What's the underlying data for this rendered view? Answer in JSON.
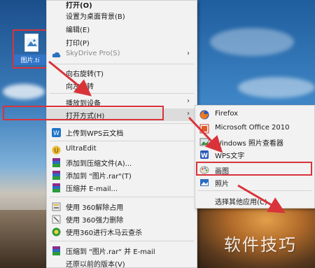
{
  "desktop": {
    "icon_label": "图片.ti"
  },
  "context_menu": {
    "items": [
      {
        "label": "打开(O)",
        "icon": "none"
      },
      {
        "label": "设置为桌面背景(B)",
        "icon": "none"
      },
      {
        "label": "编辑(E)",
        "icon": "none"
      },
      {
        "label": "打印(P)",
        "icon": "none"
      },
      {
        "label": "SkyDrive Pro(S)",
        "icon": "cloud-icon",
        "disabled": true,
        "submenu": true
      },
      {
        "label": "向右旋转(T)",
        "icon": "none"
      },
      {
        "label": "向左旋转",
        "icon": "none"
      },
      {
        "label": "播放到设备",
        "icon": "none",
        "submenu": true
      },
      {
        "label": "打开方式(H)",
        "icon": "none",
        "submenu": true,
        "highlighted": true
      },
      {
        "label": "上传到WPS云文档",
        "icon": "wps-cloud-icon"
      },
      {
        "label": "UltraEdit",
        "icon": "ultraedit-icon"
      },
      {
        "label": "添加到压缩文件(A)...",
        "icon": "winrar-icon"
      },
      {
        "label": "添加到 \"图片.rar\"(T)",
        "icon": "winrar-icon"
      },
      {
        "label": "压缩并 E-mail...",
        "icon": "winrar-icon"
      },
      {
        "label": "使用 360解除占用",
        "icon": "360-unlock-icon"
      },
      {
        "label": "使用 360强力删除",
        "icon": "360-delete-icon"
      },
      {
        "label": "使用360进行木马云查杀",
        "icon": "360-scan-icon"
      },
      {
        "label": "压缩到 \"图片.rar\" 并 E-mail",
        "icon": "winrar-icon"
      },
      {
        "label": "还原以前的版本(V)",
        "icon": "none"
      }
    ]
  },
  "open_with_submenu": {
    "items": [
      {
        "label": "Firefox",
        "icon": "firefox-icon"
      },
      {
        "label": "Microsoft Office 2010",
        "icon": "office-icon"
      },
      {
        "label": "Windows 照片查看器",
        "icon": "photo-viewer-icon"
      },
      {
        "label": "WPS文字",
        "icon": "wps-writer-icon"
      },
      {
        "label": "画图",
        "icon": "paint-icon",
        "highlighted": true
      },
      {
        "label": "照片",
        "icon": "photos-icon"
      },
      {
        "label": "选择其他应用(C)",
        "icon": "none"
      }
    ]
  },
  "watermark": "软件技巧",
  "colors": {
    "highlight_border": "#d9333a",
    "menu_bg": "#f2f2f2",
    "arrow": "#d9333a"
  }
}
